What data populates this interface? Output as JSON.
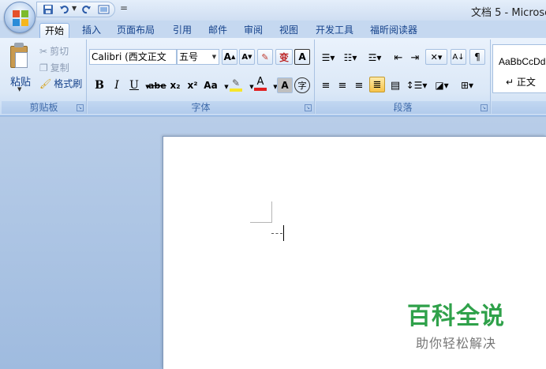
{
  "window": {
    "title": "文档 5 - Microsc"
  },
  "quick_access": {
    "customize": "="
  },
  "tabs": [
    {
      "label": "开始"
    },
    {
      "label": "插入"
    },
    {
      "label": "页面布局"
    },
    {
      "label": "引用"
    },
    {
      "label": "邮件"
    },
    {
      "label": "审阅"
    },
    {
      "label": "视图"
    },
    {
      "label": "开发工具"
    },
    {
      "label": "福昕阅读器"
    }
  ],
  "clipboard": {
    "label": "剪贴板",
    "paste": "粘贴",
    "cut": "剪切",
    "copy": "复制",
    "format_painter": "格式刷"
  },
  "font": {
    "label": "字体",
    "font_name": "Calibri (西文正文",
    "font_size": "五号",
    "bold": "B",
    "italic": "I",
    "underline": "U",
    "strike": "abe",
    "subscript": "x₂",
    "superscript": "x²",
    "change_case": "Aa",
    "highlight_color": "#f7e52a",
    "font_color_glyph": "A",
    "font_color": "#e02020",
    "char_shading": "A",
    "enclose": "字",
    "grow": "A",
    "shrink": "A",
    "phonetic": "变",
    "border": "A"
  },
  "paragraph": {
    "label": "段落"
  },
  "styles": {
    "sample": "AaBbCcDd",
    "name": "正文"
  },
  "watermark": {
    "title": "百科全说",
    "subtitle": "助你轻松解决"
  },
  "colors": {
    "office_logo": [
      "#e5512b",
      "#7cbb2b",
      "#2a8cd8",
      "#f5b61d"
    ]
  }
}
